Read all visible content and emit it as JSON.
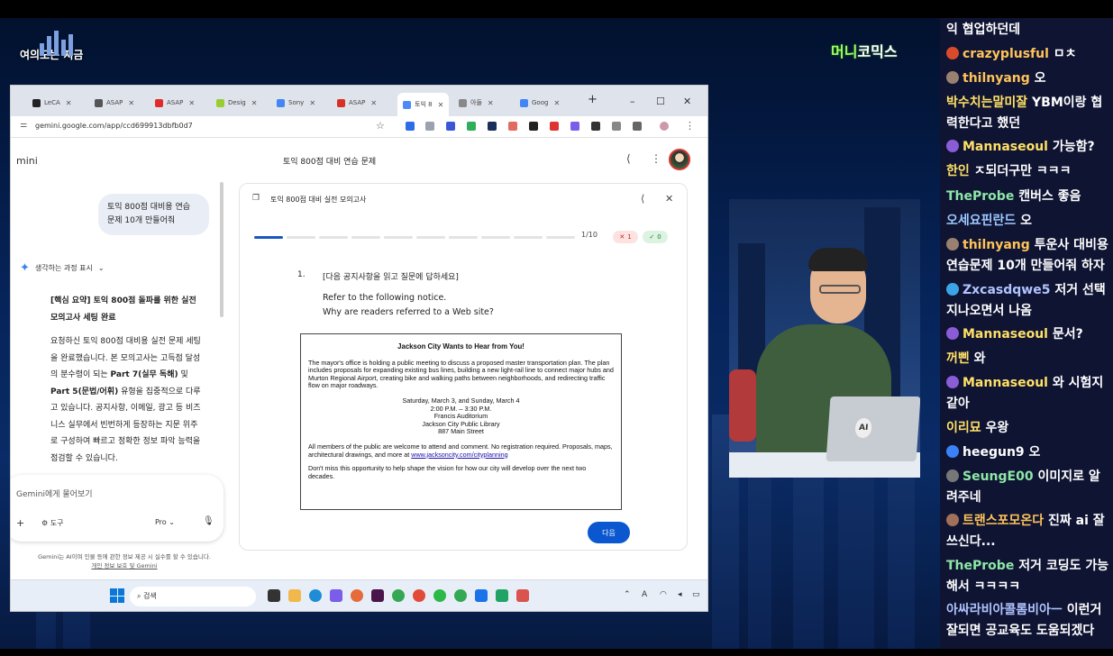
{
  "stream": {
    "logo_left": "여의도는 지금",
    "logo_right_part1": "머니",
    "logo_right_part2": "코믹스"
  },
  "browser": {
    "tabs": [
      {
        "label": "LeCA",
        "fav": "#222"
      },
      {
        "label": "ASAP",
        "fav": "#555"
      },
      {
        "label": "ASAP",
        "fav": "#e02b2b"
      },
      {
        "label": "Desig",
        "fav": "#9acd32"
      },
      {
        "label": "Sony",
        "fav": "#4285f4"
      },
      {
        "label": "ASAP",
        "fav": "#d93025"
      },
      {
        "label": "토익 8",
        "fav": "#4c8bf5"
      },
      {
        "label": "아들",
        "fav": "#888"
      },
      {
        "label": "Goog",
        "fav": "#4285f4"
      }
    ],
    "new_tab": "+",
    "minimize": "–",
    "maximize": "☐",
    "close": "✕",
    "url": "gemini.google.com/app/ccd699913dbfb0d7"
  },
  "gemini": {
    "brand": "mini",
    "doc_title": "토익 800점 대비 연습 문제",
    "user_message": "토익 800점 대비용 연습 문제 10개 만들어줘",
    "thinking_label": "생각하는 과정 표시",
    "summary_title": "[핵심 요약] 토익 800점 돌파를 위한 실전 모의고사 세팅 완료",
    "summary_body_1": "요청하신 토익 800점 대비용 실전 문제 세팅을 완료했습니다. 본 모의고사는 고득점 달성의 분수령이 되는 ",
    "summary_bold_1": "Part 7(실무 독해)",
    "summary_body_2": " 및 ",
    "summary_bold_2": "Part 5(문법/어휘)",
    "summary_body_3": " 유형을 집중적으로 다루고 있습니다. 공지사항, 이메일, 광고 등 비즈니스 실무에서 빈번하게 등장하는 지문 위주로 구성하여 빠르고 정확한 정보 파악 능력을 점검할 수 있습니다.",
    "input_placeholder": "Gemini에게 물어보기",
    "tools_label": "도구",
    "model_label": "Pro",
    "disclaimer": "Gemini는 AI이며 인물 등에 관한 정보 제공 시 실수를 할 수 있습니다.",
    "disclaimer_link": "개인 정보 보호 및 Gemini"
  },
  "quiz": {
    "panel_title": "토익 800점 대비 실전 모의고사",
    "progress": {
      "current": 1,
      "total": 10
    },
    "counter": "1/10",
    "wrong_count": "1",
    "correct_count": "0",
    "question_number": "1.",
    "instruction": "[다음 공지사항을 읽고 질문에 답하세요]",
    "line1": "Refer to the following notice.",
    "line2": "Why are readers referred to a Web site?",
    "notice": {
      "title": "Jackson City Wants to Hear from You!",
      "para1": "The mayor's office is holding a public meeting to discuss a proposed master transportation plan. The plan includes proposals for expanding existing bus lines, building a new light-rail line to connect major hubs and Murton Regional Airport, creating bike and walking paths between neighborhoods, and redirecting traffic flow on major roadways.",
      "date": "Saturday, March 3, and Sunday, March 4",
      "time": "2:00 P.M. – 3:30 P.M.",
      "venue": "Francis Auditorium",
      "library": "Jackson City Public Library",
      "street": "887 Main Street",
      "para2": "All members of the public are welcome to attend and comment. No registration required. Proposals, maps, architectural drawings, and more at ",
      "link": "www.jacksoncity.com/cityplanning",
      "para3": "Don't miss this opportunity to help shape the vision for how our city will develop over the next two decades."
    },
    "next_button": "다음"
  },
  "taskbar": {
    "search_label": "검색",
    "tray_a": "A"
  },
  "chat": [
    {
      "nick": "",
      "text": "익 협업하던데",
      "color": "#ffffff",
      "dot": ""
    },
    {
      "nick": "crazyplusful",
      "text": "ㅁㅊ",
      "color": "#ffc35a",
      "dot": "#d84b2a"
    },
    {
      "nick": "thilnyang",
      "text": "오",
      "color": "#ffc35a",
      "dot": "#9a8070"
    },
    {
      "nick": "박수치는말미잘",
      "text": "YBM이랑 협력한다고 했던",
      "color": "#ffe066",
      "dot": ""
    },
    {
      "nick": "Mannaseoul",
      "text": "가능함?",
      "color": "#ffe066",
      "dot": "#8a5cd6"
    },
    {
      "nick": "한인",
      "text": "ㅈ되더구만 ㅋㅋㅋ",
      "color": "#ffe066",
      "dot": ""
    },
    {
      "nick": "TheProbe",
      "text": "캔버스 좋음",
      "color": "#8ee6a6",
      "dot": ""
    },
    {
      "nick": "오세요핀란드",
      "text": "오",
      "color": "#9ec9ff",
      "dot": ""
    },
    {
      "nick": "thilnyang",
      "text": "투운사 대비용 연습문제 10개 만들어줘 하자",
      "color": "#ffc35a",
      "dot": "#9a8070"
    },
    {
      "nick": "Zxcasdqwe5",
      "text": "저거 선택 지나오면서 나옴",
      "color": "#b0c4ff",
      "dot": "#3ba4e8"
    },
    {
      "nick": "Mannaseoul",
      "text": "문서?",
      "color": "#ffe066",
      "dot": "#8a5cd6"
    },
    {
      "nick": "꺼삔",
      "text": "와",
      "color": "#ffe066",
      "dot": ""
    },
    {
      "nick": "Mannaseoul",
      "text": "와 시험지 같아",
      "color": "#ffe066",
      "dot": "#8a5cd6"
    },
    {
      "nick": "이리묘",
      "text": "우왕",
      "color": "#ffe066",
      "dot": ""
    },
    {
      "nick": "heegun9",
      "text": "오",
      "color": "#ffffff",
      "dot": "#3b82f6"
    },
    {
      "nick": "SeungE00",
      "text": "이미지로 알려주네",
      "color": "#8ee6a6",
      "dot": "#777"
    },
    {
      "nick": "트랜스포모온다",
      "text": "진짜 ai 잘 쓰신다...",
      "color": "#ffc35a",
      "dot": "#a0705a"
    },
    {
      "nick": "TheProbe",
      "text": "저거 코딩도 가능해서 ㅋㅋㅋㅋ",
      "color": "#8ee6a6",
      "dot": ""
    },
    {
      "nick": "아싸라비아콜롬비아ㅡ",
      "text": "이런거 잘되면 공교육도 도움되겠다",
      "color": "#b0c4ff",
      "dot": ""
    }
  ]
}
